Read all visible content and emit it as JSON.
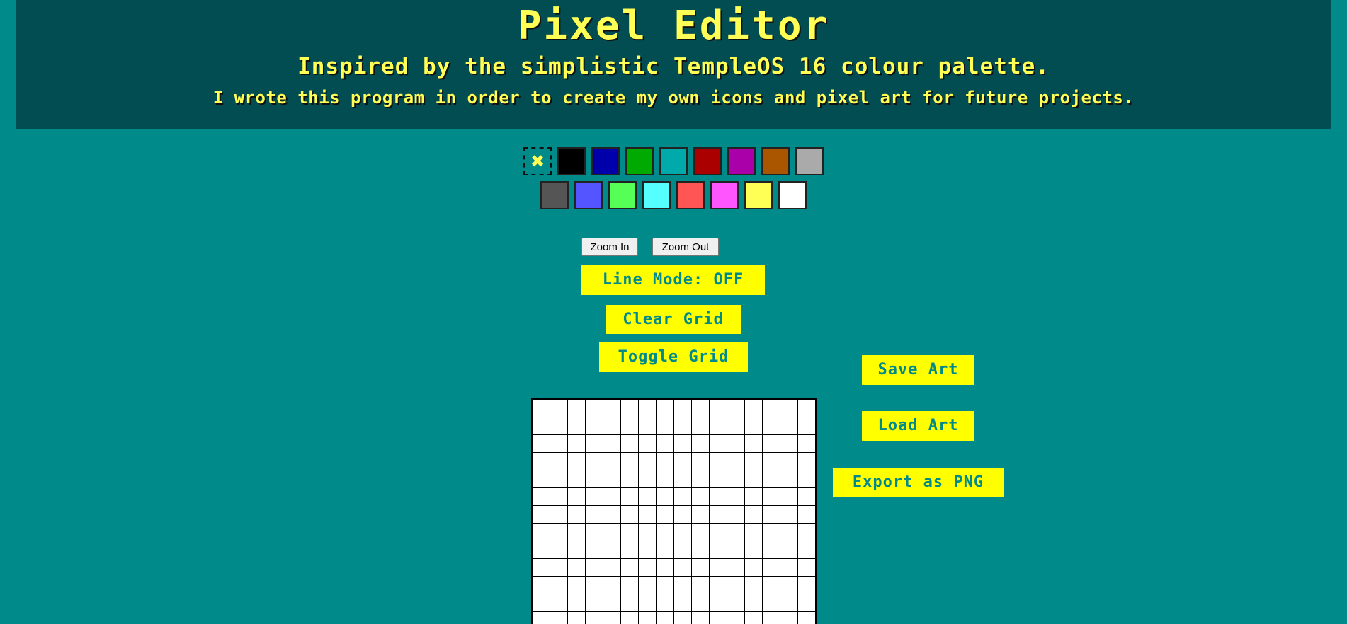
{
  "header": {
    "title": "Pixel Editor",
    "subtitle": "Inspired by the simplistic TempleOS 16 colour palette.",
    "description": "I wrote this program in order to create my own icons and pixel art for future projects."
  },
  "palette": {
    "eraser_glyph": "✖",
    "row1": [
      "#000000",
      "#0000aa",
      "#00aa00",
      "#00aaaa",
      "#aa0000",
      "#aa00aa",
      "#aa5500",
      "#aaaaaa"
    ],
    "row2": [
      "#555555",
      "#5555ff",
      "#55ff55",
      "#55ffff",
      "#ff5555",
      "#ff55ff",
      "#ffff55",
      "#ffffff"
    ]
  },
  "controls": {
    "zoom_in": "Zoom In",
    "zoom_out": "Zoom Out",
    "line_mode": "Line Mode: OFF",
    "clear_grid": "Clear Grid",
    "toggle_grid": "Toggle Grid"
  },
  "file_actions": {
    "save": "Save Art",
    "load": "Load Art",
    "export": "Export as PNG"
  },
  "colors": {
    "page_background": "#008a8a",
    "header_background": "#014d52",
    "accent_yellow": "#ffff00",
    "title_yellow": "#ffff55"
  },
  "canvas": {
    "columns": 16
  }
}
